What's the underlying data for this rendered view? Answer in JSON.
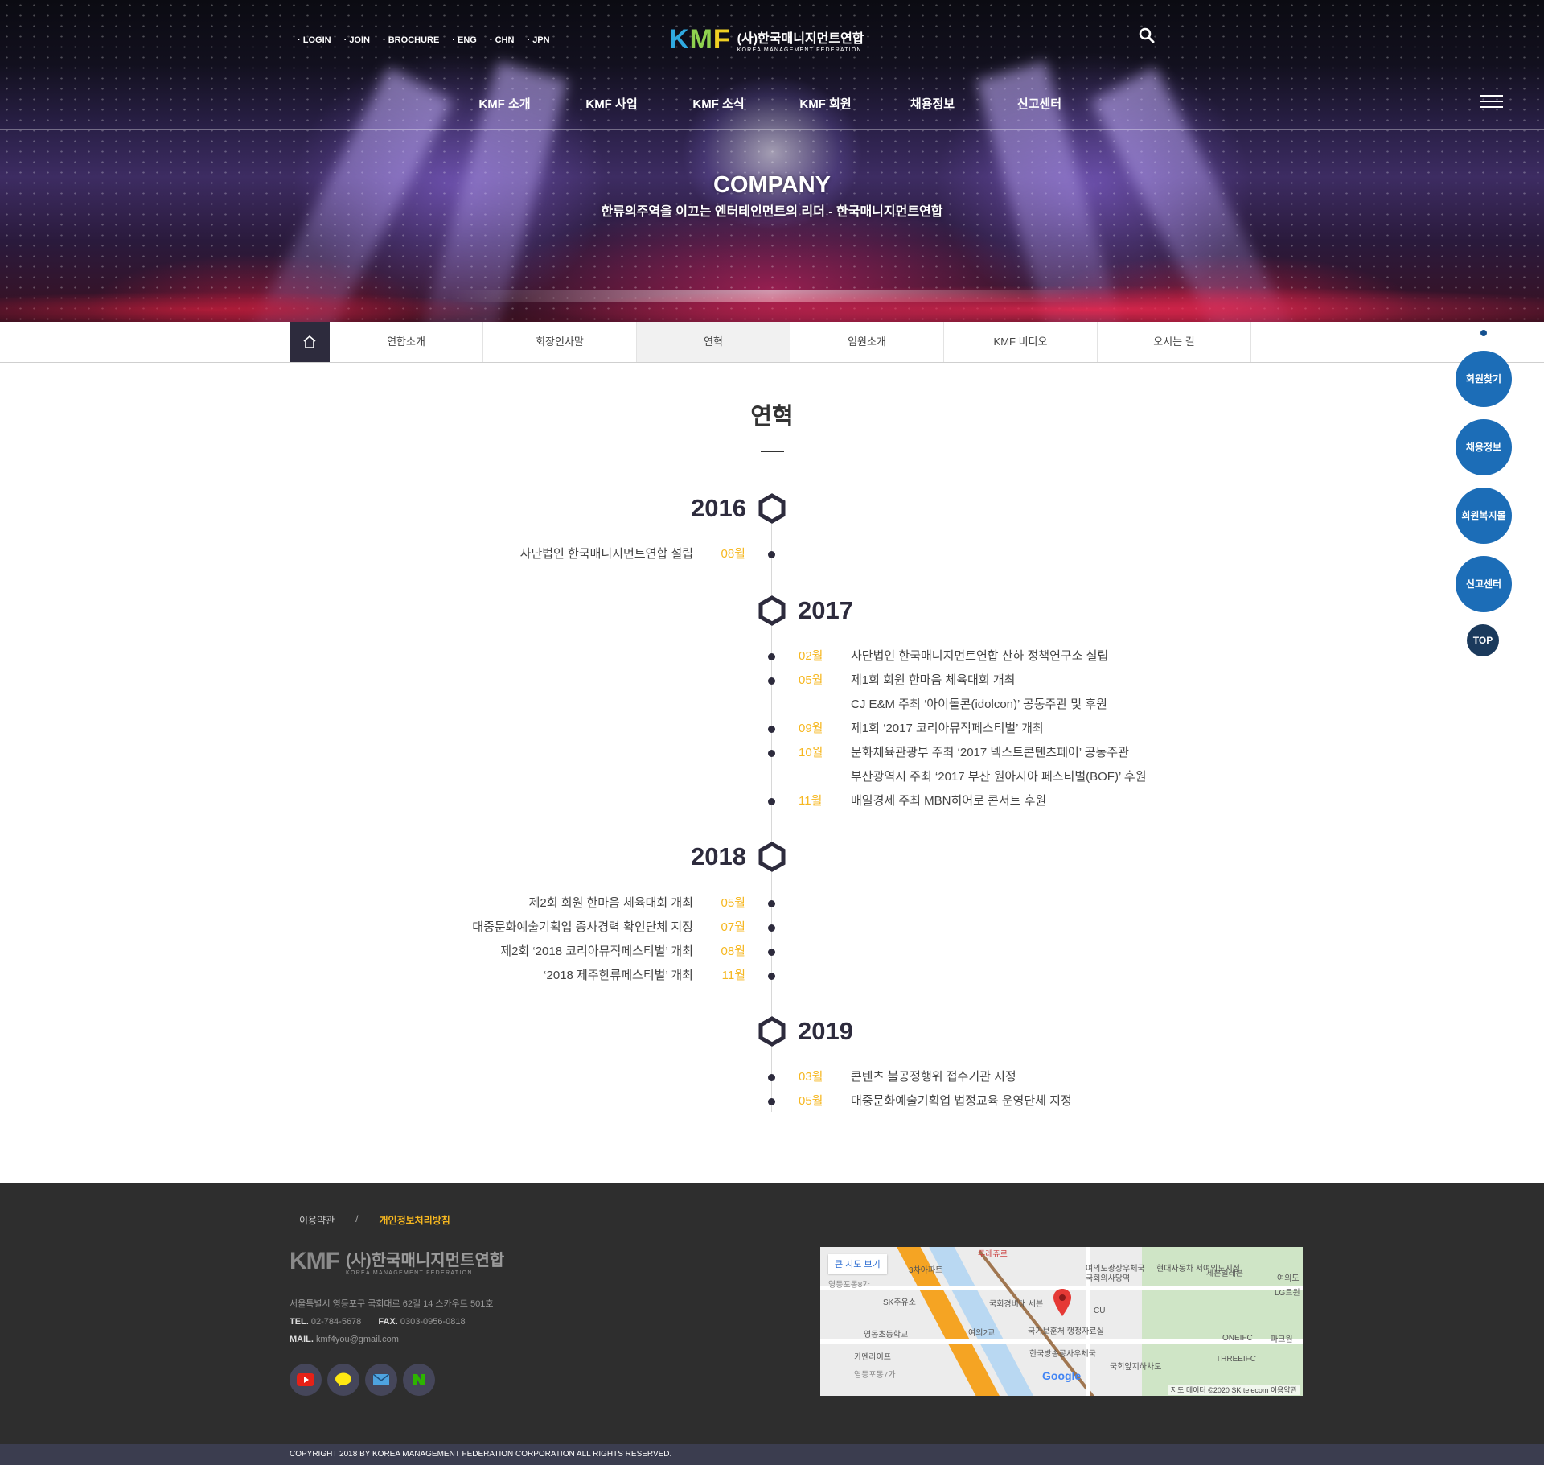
{
  "header": {
    "util_links": [
      "LOGIN",
      "JOIN",
      "BROCHURE",
      "ENG",
      "CHN",
      "JPN"
    ],
    "logo": {
      "mark_k": "K",
      "mark_m": "M",
      "mark_f": "F",
      "name_ko": "(사)한국매니지먼트연합",
      "name_en": "KOREA MANAGEMENT FEDERATION"
    },
    "search": {
      "value": "",
      "placeholder": "",
      "icon": "search-icon"
    },
    "gnb": [
      "KMF 소개",
      "KMF 사업",
      "KMF 소식",
      "KMF 회원",
      "채용정보",
      "신고센터"
    ],
    "menu_icon": "hamburger-icon"
  },
  "hero": {
    "title": "COMPANY",
    "subtitle": "한류의주역을 이끄는 엔터테인먼트의 리더 - 한국매니지먼트연합"
  },
  "subnav": {
    "home_icon": "home-icon",
    "tabs": [
      "연합소개",
      "회장인사말",
      "연혁",
      "임원소개",
      "KMF 비디오",
      "오시는 길"
    ],
    "active": "연혁"
  },
  "page_title": "연혁",
  "timeline": {
    "2016": {
      "year": "2016",
      "items": [
        {
          "month": "08월",
          "text": "사단법인 한국매니지먼트연합 설립"
        }
      ]
    },
    "2017": {
      "year": "2017",
      "items": [
        {
          "month": "02월",
          "text": "사단법인 한국매니지먼트연합 산하 정책연구소 설립"
        },
        {
          "month": "05월",
          "text": "제1회 회원 한마음 체육대회 개최"
        },
        {
          "month": "",
          "text": "CJ E&M 주최 ‘아이돌콘(idolcon)’ 공동주관 및 후원"
        },
        {
          "month": "09월",
          "text": "제1회 ‘2017 코리아뮤직페스티벌’ 개최"
        },
        {
          "month": "10월",
          "text": "문화체육관광부 주최 ‘2017 넥스트콘텐츠페어’ 공동주관"
        },
        {
          "month": "",
          "text": "부산광역시 주최 ‘2017 부산 원아시아 페스티벌(BOF)’ 후원"
        },
        {
          "month": "11월",
          "text": "매일경제 주최 MBN히어로 콘서트 후원"
        }
      ]
    },
    "2018": {
      "year": "2018",
      "items": [
        {
          "month": "05월",
          "text": "제2회 회원 한마음 체육대회 개최"
        },
        {
          "month": "07월",
          "text": "대중문화예술기획업 종사경력 확인단체 지정"
        },
        {
          "month": "08월",
          "text": "제2회 ‘2018 코리아뮤직페스티벌’ 개최"
        },
        {
          "month": "11월",
          "text": "‘2018 제주한류페스티벌’ 개최"
        }
      ]
    },
    "2019": {
      "year": "2019",
      "items": [
        {
          "month": "03월",
          "text": "콘텐츠 불공정행위 접수기관 지정"
        },
        {
          "month": "05월",
          "text": "대중문화예술기획업 법정교육 운영단체 지정"
        }
      ]
    }
  },
  "quick_menu": {
    "items": [
      "회원찾기",
      "채용정보",
      "회원복지몰",
      "신고센터"
    ],
    "top": "TOP"
  },
  "footer": {
    "links": [
      "이용약관",
      "/",
      "개인정보처리방침"
    ],
    "logo": {
      "mark": "KMF",
      "name_ko": "(사)한국매니지먼트연합",
      "name_en": "KOREA MANAGEMENT FEDERATION"
    },
    "address": "서울특별시 영등포구 국회대로 62길 14 스카우트 501호",
    "tel_label": "TEL.",
    "tel": "02-784-5678",
    "fax_label": "FAX.",
    "fax": "0303-0956-0818",
    "mail_label": "MAIL.",
    "mail": "kmf4you@gmail.com",
    "sns": [
      "youtube-icon",
      "kakaotalk-icon",
      "mail-icon",
      "naver-icon"
    ],
    "map": {
      "big_map_button": "큰 지도 보기",
      "labels": [
        "국회의사당역",
        "여의도광장우체국",
        "현대자동차 서여의도지점",
        "세븐일레븐",
        "국회경비대 세븐",
        "국가보훈처 행정자료실",
        "한국방송공사우체국",
        "국회앞지하차도",
        "영등포동8가",
        "SK주유소",
        "영동초등학교",
        "카멘라이프",
        "영등포동7가",
        "여의2교",
        "ONEIFC",
        "THREEIFC",
        "파크원",
        "LG트윈",
        "여의도",
        "CU",
        "투레쥬르",
        "3차아파트"
      ],
      "google": "Google",
      "attribution": "지도 데이터 ©2020 SK telecom  이용약관"
    },
    "copyright": "COPYRIGHT 2018 BY KOREA MANAGEMENT FEDERATION CORPORATION ALL RIGHTS RESERVED."
  },
  "colors": {
    "navy": "#2d2b3d",
    "accent_yellow": "#f6b720",
    "quick_blue": "#1c6db7",
    "top_navy": "#1b3a5c",
    "footer_bg": "#2e2e2e"
  }
}
